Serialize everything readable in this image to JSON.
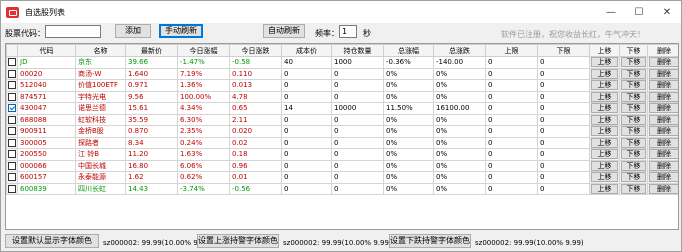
{
  "window": {
    "title": "自选股列表",
    "minimize": "—",
    "maximize": "☐",
    "close": "✕"
  },
  "toolbar": {
    "code_label": "股票代码：",
    "code_value": "",
    "add_label": "添加",
    "refresh_label": "手动刷新",
    "auto_refresh_label": "自动刷新",
    "frequency_label": "频率：",
    "frequency_value": "1",
    "seconds_label": "秒",
    "hint": "软件已注册，祝您收益长红，牛气冲天！"
  },
  "table": {
    "columns": [
      "代码",
      "名称",
      "最新价",
      "今日涨幅",
      "今日涨跌",
      "成本价",
      "持仓数量",
      "总涨幅",
      "总涨跌",
      "上限",
      "下限",
      "上移",
      "下移",
      "删除"
    ],
    "move_up_label": "上移",
    "move_down_label": "下移",
    "delete_label": "删除",
    "rows": [
      {
        "checked": false,
        "code": "JD",
        "name": "京东",
        "price": "39.66",
        "pct": "-1.47%",
        "chg": "-0.58",
        "cost": "40",
        "qty": "1000",
        "total_pct": "-0.36%",
        "total_chg": "-140.00",
        "upper": "0",
        "lower": "0",
        "color": "green"
      },
      {
        "checked": false,
        "code": "00020",
        "name": "商汤-W",
        "price": "1.640",
        "pct": "7.19%",
        "chg": "0.110",
        "cost": "0",
        "qty": "0",
        "total_pct": "0%",
        "total_chg": "0%",
        "upper": "0",
        "lower": "0",
        "color": "red"
      },
      {
        "checked": false,
        "code": "512040",
        "name": "价值100ETF",
        "price": "0.971",
        "pct": "1.36%",
        "chg": "0.013",
        "cost": "0",
        "qty": "0",
        "total_pct": "0%",
        "total_chg": "0%",
        "upper": "0",
        "lower": "0",
        "color": "red"
      },
      {
        "checked": false,
        "code": "874571",
        "name": "宇特光电",
        "price": "9.56",
        "pct": "100.00%",
        "chg": "4.78",
        "cost": "0",
        "qty": "0",
        "total_pct": "0%",
        "total_chg": "0%",
        "upper": "0",
        "lower": "0",
        "color": "red"
      },
      {
        "checked": true,
        "code": "430047",
        "name": "诺思兰德",
        "price": "15.61",
        "pct": "4.34%",
        "chg": "0.65",
        "cost": "14",
        "qty": "10000",
        "total_pct": "11.50%",
        "total_chg": "16100.00",
        "upper": "0",
        "lower": "0",
        "color": "red"
      },
      {
        "checked": false,
        "code": "688088",
        "name": "虹软科技",
        "price": "35.59",
        "pct": "6.30%",
        "chg": "2.11",
        "cost": "0",
        "qty": "0",
        "total_pct": "0%",
        "total_chg": "0%",
        "upper": "0",
        "lower": "0",
        "color": "red"
      },
      {
        "checked": false,
        "code": "900911",
        "name": "金桥B股",
        "price": "0.870",
        "pct": "2.35%",
        "chg": "0.020",
        "cost": "0",
        "qty": "0",
        "total_pct": "0%",
        "total_chg": "0%",
        "upper": "0",
        "lower": "0",
        "color": "red"
      },
      {
        "checked": false,
        "code": "300005",
        "name": "探路者",
        "price": "8.34",
        "pct": "0.24%",
        "chg": "0.02",
        "cost": "0",
        "qty": "0",
        "total_pct": "0%",
        "total_chg": "0%",
        "upper": "0",
        "lower": "0",
        "color": "red"
      },
      {
        "checked": false,
        "code": "200550",
        "name": "江 铃B",
        "price": "11.20",
        "pct": "1.63%",
        "chg": "0.18",
        "cost": "0",
        "qty": "0",
        "total_pct": "0%",
        "total_chg": "0%",
        "upper": "0",
        "lower": "0",
        "color": "red"
      },
      {
        "checked": false,
        "code": "000066",
        "name": "中国长城",
        "price": "16.80",
        "pct": "6.06%",
        "chg": "0.96",
        "cost": "0",
        "qty": "0",
        "total_pct": "0%",
        "total_chg": "0%",
        "upper": "0",
        "lower": "0",
        "color": "red"
      },
      {
        "checked": false,
        "code": "600157",
        "name": "永泰能源",
        "price": "1.62",
        "pct": "0.62%",
        "chg": "0.01",
        "cost": "0",
        "qty": "0",
        "total_pct": "0%",
        "total_chg": "0%",
        "upper": "0",
        "lower": "0",
        "color": "red"
      },
      {
        "checked": false,
        "code": "600839",
        "name": "四川长虹",
        "price": "14.43",
        "pct": "-3.74%",
        "chg": "-0.56",
        "cost": "0",
        "qty": "0",
        "total_pct": "0%",
        "total_chg": "0%",
        "upper": "0",
        "lower": "0",
        "color": "green"
      }
    ]
  },
  "bottom": {
    "default_color_label": "设置默认显示字体颜色",
    "default_sample": "sz000002: 99.99(10.00% 9.99)",
    "up_color_label": "设置上涨持警字体颜色",
    "up_sample": "sz000002: 99.99(10.00% 9.99)",
    "down_color_label": "设置下跌持警字体颜色",
    "down_sample": "sz000002: 99.99(10.00% 9.99)"
  },
  "colors": {
    "up": "#c00000",
    "down": "#009900",
    "focus": "#0078d7"
  }
}
